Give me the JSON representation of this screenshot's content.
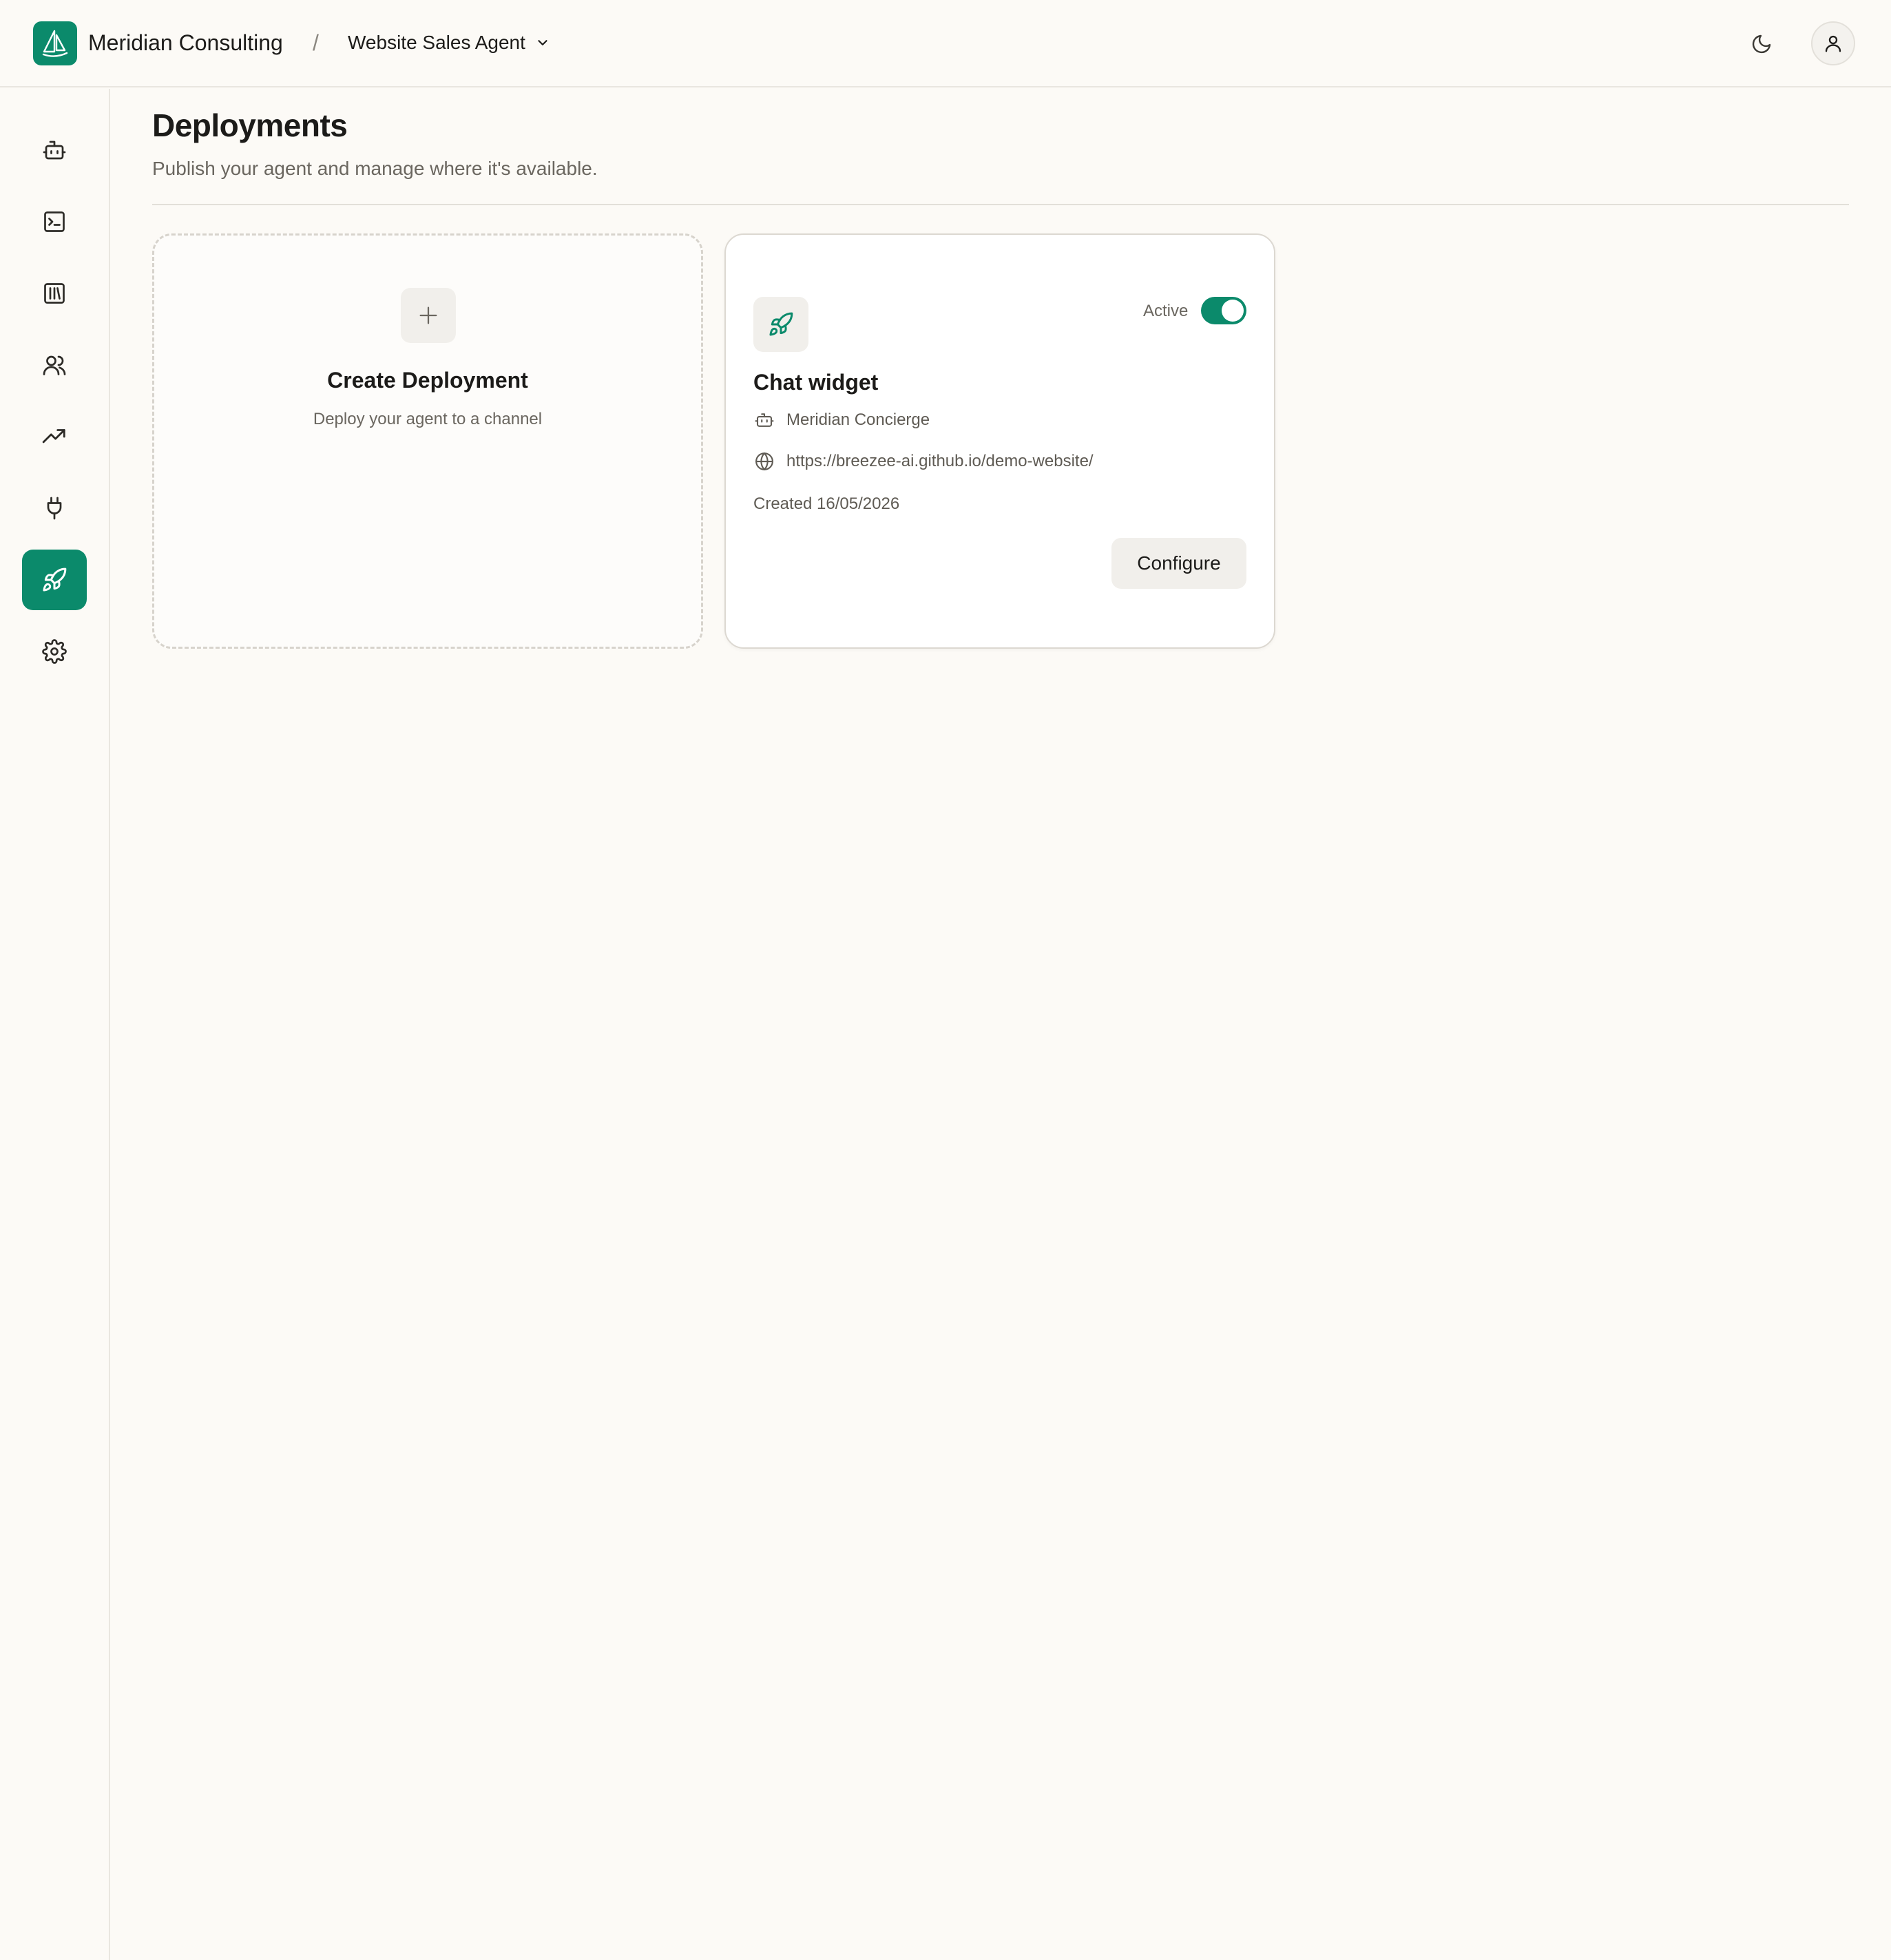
{
  "header": {
    "brand_name": "Meridian Consulting",
    "separator": "/",
    "agent_name": "Website Sales Agent"
  },
  "sidebar": {
    "items": [
      {
        "icon": "bot-icon",
        "active": false
      },
      {
        "icon": "terminal-icon",
        "active": false
      },
      {
        "icon": "library-icon",
        "active": false
      },
      {
        "icon": "users-icon",
        "active": false
      },
      {
        "icon": "trending-up-icon",
        "active": false
      },
      {
        "icon": "plug-icon",
        "active": false
      },
      {
        "icon": "rocket-icon",
        "active": true
      },
      {
        "icon": "gear-icon",
        "active": false
      }
    ]
  },
  "page": {
    "title": "Deployments",
    "subtitle": "Publish your agent and manage where it's available."
  },
  "create_card": {
    "title": "Create Deployment",
    "subtitle": "Deploy your agent to a channel"
  },
  "deployment": {
    "title": "Chat widget",
    "status_label": "Active",
    "status_on": true,
    "agent": "Meridian Concierge",
    "url": "https://breezee-ai.github.io/demo-website/",
    "created": "Created 16/05/2026",
    "configure_label": "Configure"
  },
  "colors": {
    "accent": "#0b8a6b",
    "background": "#fcfaf6",
    "text": "#1c1b19",
    "muted": "#6a665f"
  }
}
